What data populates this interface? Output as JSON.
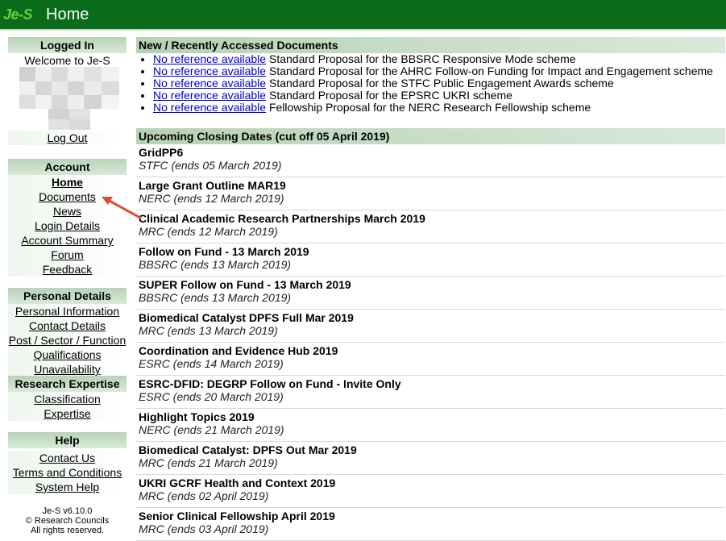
{
  "header": {
    "logo": "Je-S",
    "title": "Home"
  },
  "sidebar": {
    "logged_in": {
      "heading": "Logged In",
      "welcome": "Welcome to Je-S",
      "logout": "Log Out"
    },
    "account": {
      "heading": "Account",
      "items": [
        "Home",
        "Documents",
        "News",
        "Login Details",
        "Account Summary",
        "Forum",
        "Feedback"
      ]
    },
    "personal": {
      "heading": "Personal Details",
      "items": [
        "Personal Information",
        "Contact Details",
        "Post / Sector / Function",
        "Qualifications",
        "Unavailability"
      ]
    },
    "research": {
      "heading": "Research Expertise",
      "items": [
        "Classification",
        "Expertise"
      ]
    },
    "help": {
      "heading": "Help",
      "items": [
        "Contact Us",
        "Terms and Conditions",
        "System Help"
      ]
    },
    "footer": {
      "version": "Je-S v6.10.0",
      "copyright": "© Research Councils",
      "rights": "All rights reserved."
    }
  },
  "recent": {
    "heading": "New / Recently Accessed Documents",
    "items": [
      {
        "link": "No reference available",
        "text": "Standard Proposal for the BBSRC Responsive Mode scheme"
      },
      {
        "link": "No reference available",
        "text": "Standard Proposal for the AHRC Follow-on Funding for Impact and Engagement scheme"
      },
      {
        "link": "No reference available",
        "text": "Standard Proposal for the STFC Public Engagement Awards scheme"
      },
      {
        "link": "No reference available",
        "text": "Standard Proposal for the EPSRC UKRI scheme"
      },
      {
        "link": "No reference available",
        "text": "Fellowship Proposal for the NERC Research Fellowship scheme"
      }
    ]
  },
  "closing": {
    "heading": "Upcoming Closing Dates (cut off 05 April 2019)",
    "items": [
      {
        "title": "GridPP6",
        "sub": "STFC (ends 05 March 2019)"
      },
      {
        "title": "Large Grant Outline MAR19",
        "sub": "NERC (ends 12 March 2019)"
      },
      {
        "title": "Clinical Academic Research Partnerships March 2019",
        "sub": "MRC (ends 12 March 2019)"
      },
      {
        "title": "Follow on Fund - 13 March 2019",
        "sub": "BBSRC (ends 13 March 2019)"
      },
      {
        "title": "SUPER Follow on Fund - 13 March 2019",
        "sub": "BBSRC (ends 13 March 2019)"
      },
      {
        "title": "Biomedical Catalyst DPFS Full Mar 2019",
        "sub": "MRC (ends 13 March 2019)"
      },
      {
        "title": "Coordination and Evidence Hub 2019",
        "sub": "ESRC (ends 14 March 2019)"
      },
      {
        "title": "ESRC-DFID: DEGRP Follow on Fund - Invite Only",
        "sub": "ESRC (ends 20 March 2019)"
      },
      {
        "title": "Highlight Topics 2019",
        "sub": "NERC (ends 21 March 2019)"
      },
      {
        "title": "Biomedical Catalyst: DPFS Out Mar 2019",
        "sub": "MRC (ends 21 March 2019)"
      },
      {
        "title": "UKRI GCRF Health and Context 2019",
        "sub": "MRC (ends 02 April 2019)"
      },
      {
        "title": "Senior Clinical Fellowship April 2019",
        "sub": "MRC (ends 03 April 2019)"
      }
    ]
  },
  "colors": {
    "topbar": "#0a6b1a",
    "section_header": "#c9dfc9",
    "link": "#0000cc",
    "arrow": "#e04a3a"
  },
  "icons": {
    "annotation": "red-arrow-icon"
  }
}
